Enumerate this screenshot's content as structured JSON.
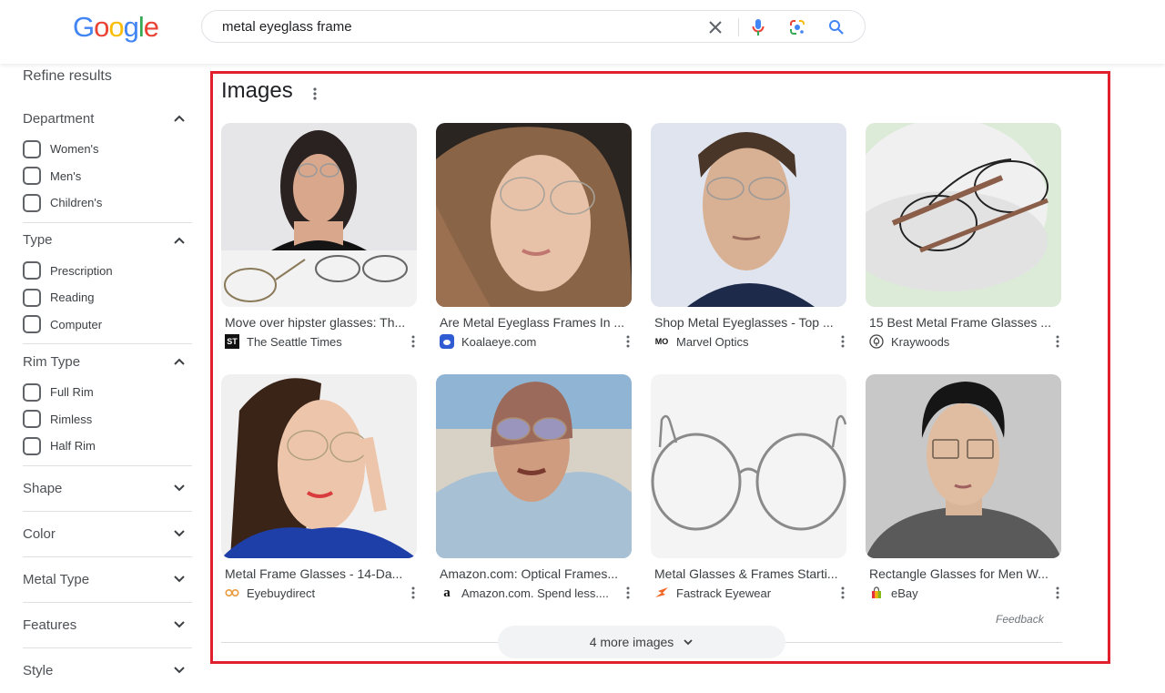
{
  "header": {
    "logo": [
      "G",
      "o",
      "o",
      "g",
      "l",
      "e"
    ],
    "logo_colors": [
      "#4285f4",
      "#ea4335",
      "#fbbc05",
      "#4285f4",
      "#34a853",
      "#ea4335"
    ],
    "search_query": "metal eyeglass frame",
    "icons": [
      "clear-icon",
      "microphone-icon",
      "google-lens-icon",
      "search-icon"
    ]
  },
  "sidebar": {
    "title": "Refine results",
    "facets": [
      {
        "label": "Department",
        "expanded": true,
        "options": [
          "Women's",
          "Men's",
          "Children's"
        ]
      },
      {
        "label": "Type",
        "expanded": true,
        "options": [
          "Prescription",
          "Reading",
          "Computer"
        ]
      },
      {
        "label": "Rim Type",
        "expanded": true,
        "options": [
          "Full Rim",
          "Rimless",
          "Half Rim"
        ]
      },
      {
        "label": "Shape",
        "expanded": false
      },
      {
        "label": "Color",
        "expanded": false
      },
      {
        "label": "Metal Type",
        "expanded": false
      },
      {
        "label": "Features",
        "expanded": false
      },
      {
        "label": "Style",
        "expanded": false
      }
    ]
  },
  "images_section": {
    "title": "Images",
    "highlight_color": "#e0202c",
    "results": [
      {
        "title": "Move over hipster glasses: Th...",
        "source": "The Seattle Times",
        "favicon": "seattle-times-icon"
      },
      {
        "title": "Are Metal Eyeglass Frames In ...",
        "source": "Koalaeye.com",
        "favicon": "koalaeye-icon"
      },
      {
        "title": "Shop Metal Eyeglasses - Top ...",
        "source": "Marvel Optics",
        "favicon": "marvel-optics-icon"
      },
      {
        "title": "15 Best Metal Frame Glasses ...",
        "source": "Kraywoods",
        "favicon": "kraywoods-icon"
      },
      {
        "title": "Metal Frame Glasses - 14-Da...",
        "source": "Eyebuydirect",
        "favicon": "eyebuydirect-icon"
      },
      {
        "title": "Amazon.com: Optical Frames...",
        "source": "Amazon.com. Spend less....",
        "favicon": "amazon-icon"
      },
      {
        "title": "Metal Glasses & Frames Starti...",
        "source": "Fastrack Eyewear",
        "favicon": "fastrack-icon"
      },
      {
        "title": "Rectangle Glasses for Men W...",
        "source": "eBay",
        "favicon": "ebay-icon"
      }
    ],
    "feedback_label": "Feedback",
    "more_label": "4 more images"
  }
}
